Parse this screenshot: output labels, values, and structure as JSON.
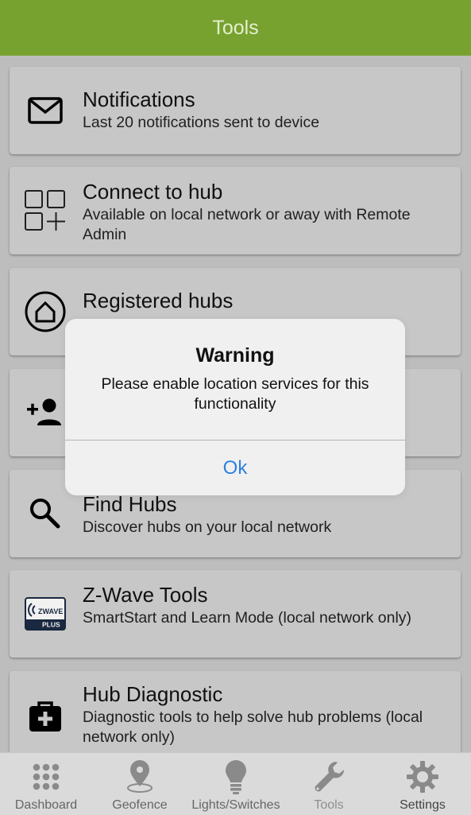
{
  "header": {
    "title": "Tools"
  },
  "items": [
    {
      "title": "Notifications",
      "desc": "Last 20 notifications sent to device"
    },
    {
      "title": "Connect to hub",
      "desc": "Available on local network or away with Remote Admin"
    },
    {
      "title": "Registered hubs",
      "desc": ""
    },
    {
      "title": "",
      "desc": ""
    },
    {
      "title": "Find Hubs",
      "desc": "Discover hubs on your local network"
    },
    {
      "title": "Z-Wave Tools",
      "desc": "SmartStart and Learn Mode (local network only)"
    },
    {
      "title": "Hub Diagnostic",
      "desc": "Diagnostic tools to help solve hub problems (local network only)"
    }
  ],
  "icons": {
    "notifications": "envelope-icon",
    "connect": "grid-plus-icon",
    "registered": "hub-home-icon",
    "add_user": "add-person-icon",
    "find": "magnifier-icon",
    "zwave": "zwave-plus-logo",
    "diagnostic": "medical-kit-icon",
    "zwave_logo_text": "Z WAVE",
    "zwave_logo_sub": "PLUS"
  },
  "dialog": {
    "title": "Warning",
    "message": "Please enable location services for this functionality",
    "button": "Ok"
  },
  "tabs": [
    {
      "label": "Dashboard",
      "icon": "dots-grid-icon"
    },
    {
      "label": "Geofence",
      "icon": "location-pin-icon"
    },
    {
      "label": "Lights/Switches",
      "icon": "lightbulb-icon"
    },
    {
      "label": "Tools",
      "icon": "wrench-icon"
    },
    {
      "label": "Settings",
      "icon": "gear-icon"
    }
  ],
  "colors": {
    "header_bg": "#78a22f",
    "accent_button": "#2f7fe0",
    "card_bg": "#d2d2d2",
    "tab_icon": "#8a8a8a"
  }
}
